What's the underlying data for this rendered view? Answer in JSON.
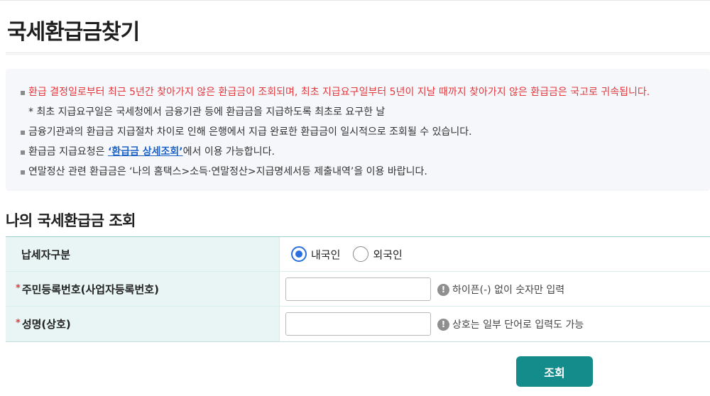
{
  "page": {
    "title": "국세환급금찾기"
  },
  "notice": {
    "line1": "환급 결정일로부터 최근 5년간 찾아가지 않은 환급금이 조회되며, 최초 지급요구일부터 5년이 지날 때까지 찾아가지 않은 환급금은 국고로 귀속됩니다.",
    "line2": "* 최초 지급요구일은 국세청에서 금융기관 등에 환급금을 지급하도록 최초로 요구한 날",
    "line3": "금융기관과의 환급금 지급절차 차이로 인해 은행에서 지급 완료한 환급금이 일시적으로 조회될 수 있습니다.",
    "line4_prefix": "환급금 지급요청은 ",
    "line4_link": "‘환급금 상세조회’",
    "line4_suffix": "에서 이용 가능합니다.",
    "line5": "연말정산 관련 환급금은 ‘나의 홈택스>소득·연말정산>지급명세서등 제출내역’을 이용 바랍니다.",
    "bullet": "▪"
  },
  "section": {
    "title": "나의 국세환급금 조회"
  },
  "form": {
    "taxpayer_type": {
      "label": "납세자구분",
      "options": [
        {
          "label": "내국인",
          "selected": true
        },
        {
          "label": "외국인",
          "selected": false
        }
      ]
    },
    "id_number": {
      "required_mark": "*",
      "label": "주민등록번호(사업자등록번호)",
      "value": "",
      "hint": "하이픈(-) 없이 숫자만 입력"
    },
    "name": {
      "required_mark": "*",
      "label": "성명(상호)",
      "value": "",
      "hint": "상호는 일부 단어로 입력도 가능"
    },
    "hint_icon_glyph": "!"
  },
  "actions": {
    "search_label": "조회"
  },
  "colors": {
    "accent": "#158c8c",
    "alert": "#e3373c",
    "link": "#1f63c6",
    "label_bg": "#e8f5f4"
  }
}
